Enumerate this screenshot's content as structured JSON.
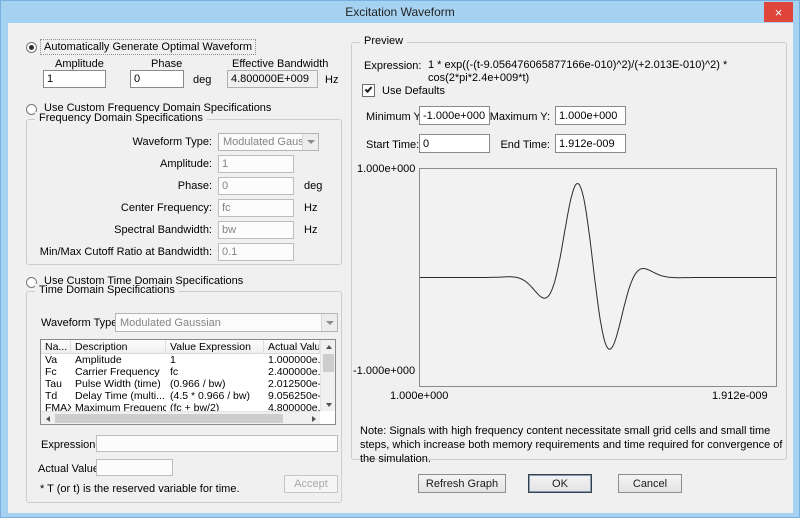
{
  "window": {
    "title": "Excitation Waveform",
    "close_icon": "×"
  },
  "colors": {
    "titlebar": "#a6d2f2",
    "close_button": "#e0453c",
    "dialog_bg": "#f0f0f0",
    "accent_border": "#7ab0dd"
  },
  "auto_section": {
    "radio_label": "Automatically Generate Optimal Waveform",
    "amplitude_label": "Amplitude",
    "amplitude_value": "1",
    "phase_label": "Phase",
    "phase_value": "0",
    "phase_unit": "deg",
    "bandwidth_label": "Effective Bandwidth",
    "bandwidth_value": "4.800000E+009",
    "bandwidth_unit": "Hz"
  },
  "freq_section": {
    "radio_label": "Use Custom Frequency Domain Specifications",
    "group_title": "Frequency Domain Specifications",
    "rows": [
      {
        "label": "Waveform Type:",
        "value": "Modulated Gaussian"
      },
      {
        "label": "Amplitude:",
        "value": "1",
        "unit": ""
      },
      {
        "label": "Phase:",
        "value": "0",
        "unit": "deg"
      },
      {
        "label": "Center Frequency:",
        "value": "fc",
        "unit": "Hz"
      },
      {
        "label": "Spectral Bandwidth:",
        "value": "bw",
        "unit": "Hz"
      },
      {
        "label": "Min/Max Cutoff Ratio at Bandwidth:",
        "value": "0.1",
        "unit": ""
      }
    ]
  },
  "time_section": {
    "radio_label": "Use Custom Time Domain Specifications",
    "group_title": "Time Domain Specifications",
    "waveform_type_label": "Waveform Type:",
    "waveform_type_value": "Modulated Gaussian",
    "table": {
      "headers": [
        "Na...",
        "Description",
        "Value Expression",
        "Actual Value"
      ],
      "rows": [
        {
          "name": "Va",
          "description": "Amplitude",
          "value_expression": "1",
          "actual_value": "1.000000e.."
        },
        {
          "name": "Fc",
          "description": "Carrier Frequency",
          "value_expression": "fc",
          "actual_value": "2.400000e.."
        },
        {
          "name": "Tau",
          "description": "Pulse Width (time)",
          "value_expression": "(0.966 / bw)",
          "actual_value": "2.012500e-."
        },
        {
          "name": "Td",
          "description": "Delay Time (multi...",
          "value_expression": "(4.5 * 0.966 / bw)",
          "actual_value": "9.056250e-."
        },
        {
          "name": "FMAX",
          "description": "Maximum Frequency",
          "value_expression": "(fc + bw/2)",
          "actual_value": "4.800000e.."
        }
      ]
    },
    "expression_label": "Expression:",
    "expression_value": "",
    "actual_value_label": "Actual Value:",
    "actual_value": "",
    "accept_label": "Accept",
    "footnote": "* T (or t) is the reserved variable for time."
  },
  "preview": {
    "group_title": "Preview",
    "expression_label": "Expression:",
    "expression_lines": [
      "1 * exp((-(t-9.056476065877166e-010)^2)/(+2.013E-010)^2) *",
      "cos(2*pi*2.4e+009*t)"
    ],
    "use_defaults_label": "Use Defaults",
    "min_y_label": "Minimum Y:",
    "min_y_value": "-1.000e+000",
    "max_y_label": "Maximum Y:",
    "max_y_value": "1.000e+000",
    "start_time_label": "Start Time:",
    "start_time_value": "0",
    "end_time_label": "End Time:",
    "end_time_value": "1.912e-009",
    "note": "Note: Signals with high frequency content necessitate small grid cells and small time steps, which increase both memory requirements and time required for convergence of the simulation."
  },
  "chart_data": {
    "type": "line",
    "x_range": [
      0,
      1.912e-09
    ],
    "y_range": [
      -1,
      1
    ],
    "x_axis_labels": {
      "left": "1.000e+000",
      "right": "1.912e-009"
    },
    "y_axis_labels": {
      "top": "1.000e+000",
      "bottom": "-1.000e+000"
    },
    "grid": false,
    "legend": false,
    "waveform": {
      "type": "modulated_gaussian",
      "formula": "A * exp(-((t-Td)/Tau)^2) * cos(2*pi*Fc*t)",
      "A": 1,
      "Td": 9.056476065877166e-10,
      "Tau": 2.013e-10,
      "Fc": 2400000000
    }
  },
  "footer_buttons": {
    "refresh": "Refresh Graph",
    "ok": "OK",
    "cancel": "Cancel"
  }
}
